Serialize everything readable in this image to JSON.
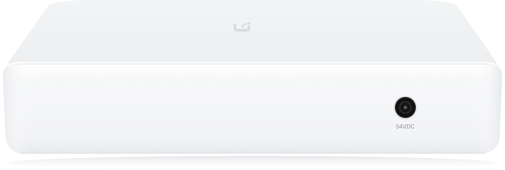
{
  "product": {
    "logo_icon": "ubiquiti-u-logo",
    "power_port_icon": "dc-barrel-jack",
    "power_port_label": "54VDC"
  },
  "colors": {
    "body": "#f6f7f8",
    "top_surface": "#f0f1f3",
    "logo": "#dcdee1",
    "port_ring": "#1a1a1a"
  }
}
